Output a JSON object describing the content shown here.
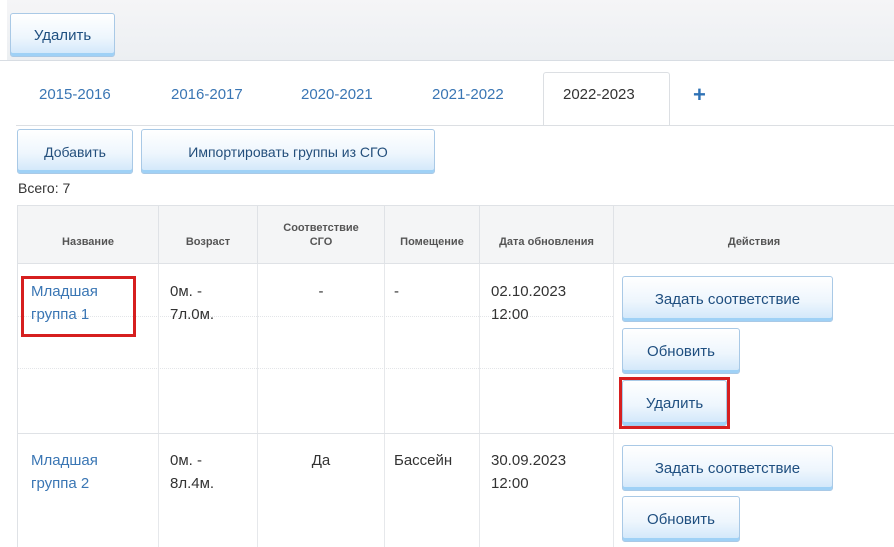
{
  "toolbar": {
    "delete_label": "Удалить"
  },
  "tabs": [
    {
      "label": "2015-2016"
    },
    {
      "label": "2016-2017"
    },
    {
      "label": "2020-2021"
    },
    {
      "label": "2021-2022"
    },
    {
      "label": "2022-2023",
      "active": true
    }
  ],
  "add_tab_label": "+",
  "actions": {
    "add_label": "Добавить",
    "import_label": "Импортировать группы из СГО"
  },
  "total_label": "Всего: 7",
  "table": {
    "headers": [
      "Название",
      "Возраст",
      "Соответствие СГО",
      "Помещение",
      "Дата обновления",
      "Действия"
    ],
    "rows": [
      {
        "name": "Младшая группа 1",
        "age": "0м. - 7л.0м.",
        "sgo": "-",
        "room": "-",
        "updated": "02.10.2023 12:00",
        "buttons": [
          "Задать соответствие",
          "Обновить",
          "Удалить"
        ]
      },
      {
        "name": "Младшая группа 2",
        "age": "0м. - 8л.4м.",
        "sgo": "Да",
        "room": "Бассейн",
        "updated": "30.09.2023 12:00",
        "buttons": [
          "Задать соответствие",
          "Обновить"
        ]
      }
    ]
  },
  "colors": {
    "link": "#3a76b4",
    "highlight": "#d61f1f",
    "button_bottom": "#9fd1f6"
  }
}
